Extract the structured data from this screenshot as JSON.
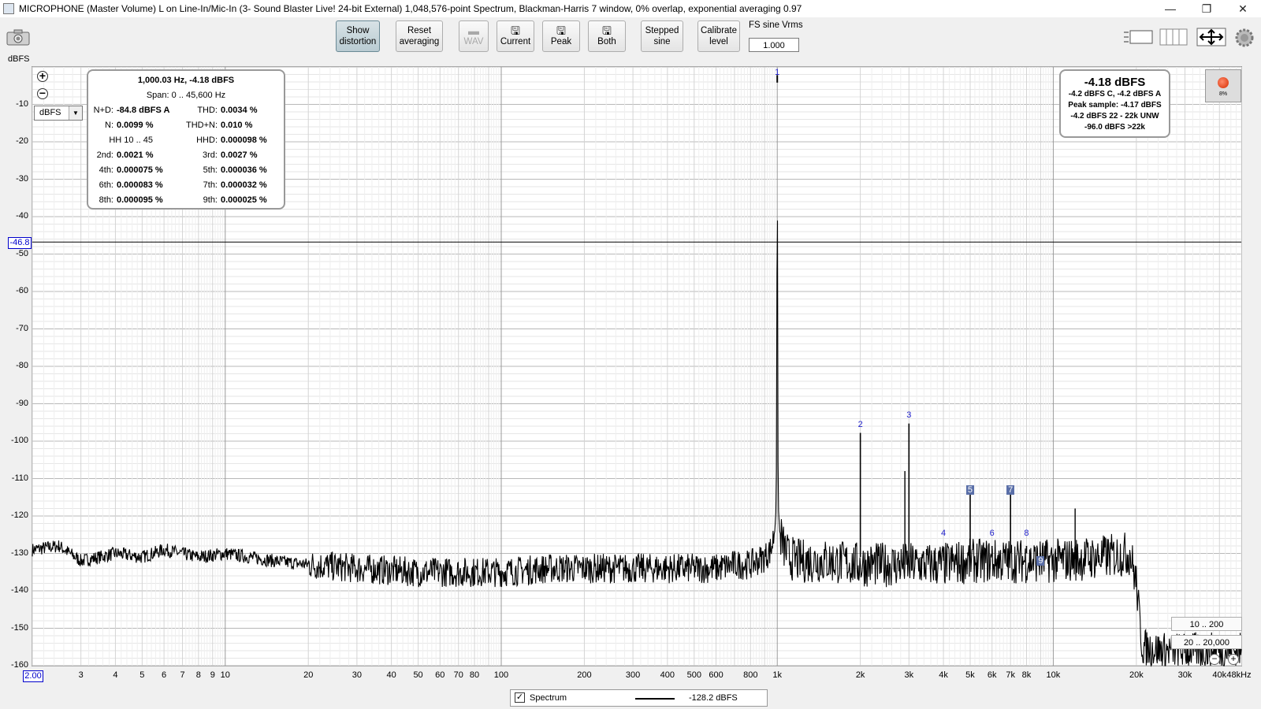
{
  "window": {
    "title": "MICROPHONE (Master Volume) L on Line-In/Mic-In (3- Sound Blaster Live! 24-bit External) 1,048,576-point Spectrum, Blackman-Harris 7 window, 0% overlap, exponential averaging 0.97",
    "minimize": "—",
    "restore": "❐",
    "close": "✕"
  },
  "toolbar": {
    "show_distortion": [
      "Show",
      "distortion"
    ],
    "reset_averaging": [
      "Reset",
      "averaging"
    ],
    "wav": "WAV",
    "current": "Current",
    "peak": "Peak",
    "both": "Both",
    "stepped_sine": [
      "Stepped",
      "sine"
    ],
    "calibrate_level": [
      "Calibrate",
      "level"
    ],
    "fs_label": "FS sine Vrms",
    "fs_value": "1.000"
  },
  "plot": {
    "y_unit": "dBFS",
    "unit_select": "dBFS",
    "cursor_y": "-46.8",
    "x_start": "2.00",
    "y_ticks": [
      "-10",
      "-20",
      "-30",
      "-40",
      "-50",
      "-60",
      "-70",
      "-80",
      "-90",
      "-100",
      "-110",
      "-120",
      "-130",
      "-140",
      "-150",
      "-160"
    ],
    "x_ticks": [
      "3",
      "4",
      "5",
      "6",
      "7",
      "8",
      "9",
      "10",
      "20",
      "30",
      "40",
      "50",
      "60",
      "70",
      "80",
      "100",
      "200",
      "300",
      "400",
      "500",
      "600",
      "800",
      "1k",
      "2k",
      "3k",
      "4k",
      "5k",
      "6k",
      "7k",
      "8k",
      "10k",
      "20k",
      "30k",
      "40k",
      "48kHz"
    ]
  },
  "distortion_panel": {
    "header": "1,000.03 Hz, -4.18 dBFS",
    "span": "Span: 0 .. 45,600 Hz",
    "rows": [
      {
        "l1": "N+D:",
        "v1": "-84.8 dBFS A",
        "l2": "THD:",
        "v2": "0.0034 %"
      },
      {
        "l1": "N:",
        "v1": "0.0099 %",
        "l2": "THD+N:",
        "v2": "0.010 %"
      },
      {
        "l1": "HH 10 .. 45",
        "v1": "",
        "l2": "HHD:",
        "v2": "0.000098 %"
      },
      {
        "l1": "2nd:",
        "v1": "0.0021 %",
        "l2": "3rd:",
        "v2": "0.0027 %"
      },
      {
        "l1": "4th:",
        "v1": "0.000075 %",
        "l2": "5th:",
        "v2": "0.000036 %"
      },
      {
        "l1": "6th:",
        "v1": "0.000083 %",
        "l2": "7th:",
        "v2": "0.000032 %"
      },
      {
        "l1": "8th:",
        "v1": "0.000095 %",
        "l2": "9th:",
        "v2": "0.000025 %"
      }
    ]
  },
  "level_panel": {
    "main": "-4.18 dBFS",
    "line1": "-4.2 dBFS C, -4.2 dBFS A",
    "line2": "Peak sample: -4.17 dBFS",
    "line3": "-4.2 dBFS 22 - 22k UNW",
    "line4": "-96.0 dBFS >22k"
  },
  "record": {
    "percent": "8%"
  },
  "ranges": {
    "r1": "10 .. 200",
    "r2": "20 .. 20,000"
  },
  "legend": {
    "checked": "✓",
    "name": "Spectrum",
    "value": "-128.2 dBFS"
  },
  "harmonic_labels": [
    "1",
    "2",
    "3",
    "4",
    "5",
    "6",
    "7",
    "8",
    "9"
  ],
  "chart_data": {
    "type": "line",
    "series": [
      {
        "name": "Spectrum",
        "x": [
          2,
          2.5,
          3,
          3.5,
          4,
          5,
          6,
          8,
          10,
          15,
          20,
          30,
          50,
          70,
          100,
          150,
          200,
          300,
          400,
          500,
          600,
          700,
          800,
          900,
          950,
          980,
          990,
          995,
          1000,
          1005,
          1010,
          1020,
          1050,
          1100,
          1200,
          1500,
          2000,
          2200,
          3000,
          4000,
          5000,
          7000,
          10000,
          15000,
          19000,
          20000,
          21000,
          25000,
          30000,
          40000,
          48000
        ],
        "y": [
          -129,
          -128,
          -132,
          -131,
          -130,
          -131,
          -129,
          -131,
          -130,
          -132,
          -133,
          -134,
          -135,
          -135,
          -135,
          -134,
          -134,
          -134,
          -134,
          -134,
          -134,
          -133,
          -133,
          -131,
          -129,
          -124,
          -118,
          -100,
          -4.18,
          -100,
          -118,
          -124,
          -128,
          -131,
          -132,
          -132,
          -133,
          -133,
          -133,
          -133,
          -132,
          -132,
          -132,
          -131,
          -130,
          -138,
          -155,
          -156,
          -156,
          -156,
          -156
        ]
      }
    ],
    "peaks": [
      {
        "label": "1",
        "freq": 1000,
        "db": -4.18
      },
      {
        "label": "2",
        "freq": 2000,
        "db": -97.8
      },
      {
        "label": "3",
        "freq": 3000,
        "db": -95.3
      },
      {
        "label": "4",
        "freq": 4000,
        "db": -129
      },
      {
        "label": "5",
        "freq": 5000,
        "db": -113
      },
      {
        "label": "6",
        "freq": 6000,
        "db": -128
      },
      {
        "label": "7",
        "freq": 7000,
        "db": -113
      },
      {
        "label": "8",
        "freq": 8000,
        "db": -128
      },
      {
        "label": "9",
        "freq": 9000,
        "db": -132
      }
    ],
    "spurs": [
      {
        "freq": 2900,
        "db": -108
      },
      {
        "freq": 12000,
        "db": -118
      }
    ],
    "xlabel": "",
    "ylabel": "dBFS",
    "xlim": [
      2,
      48000
    ],
    "ylim": [
      -160,
      0
    ],
    "x_scale": "log",
    "grid": true,
    "cursor_db": -46.8
  }
}
